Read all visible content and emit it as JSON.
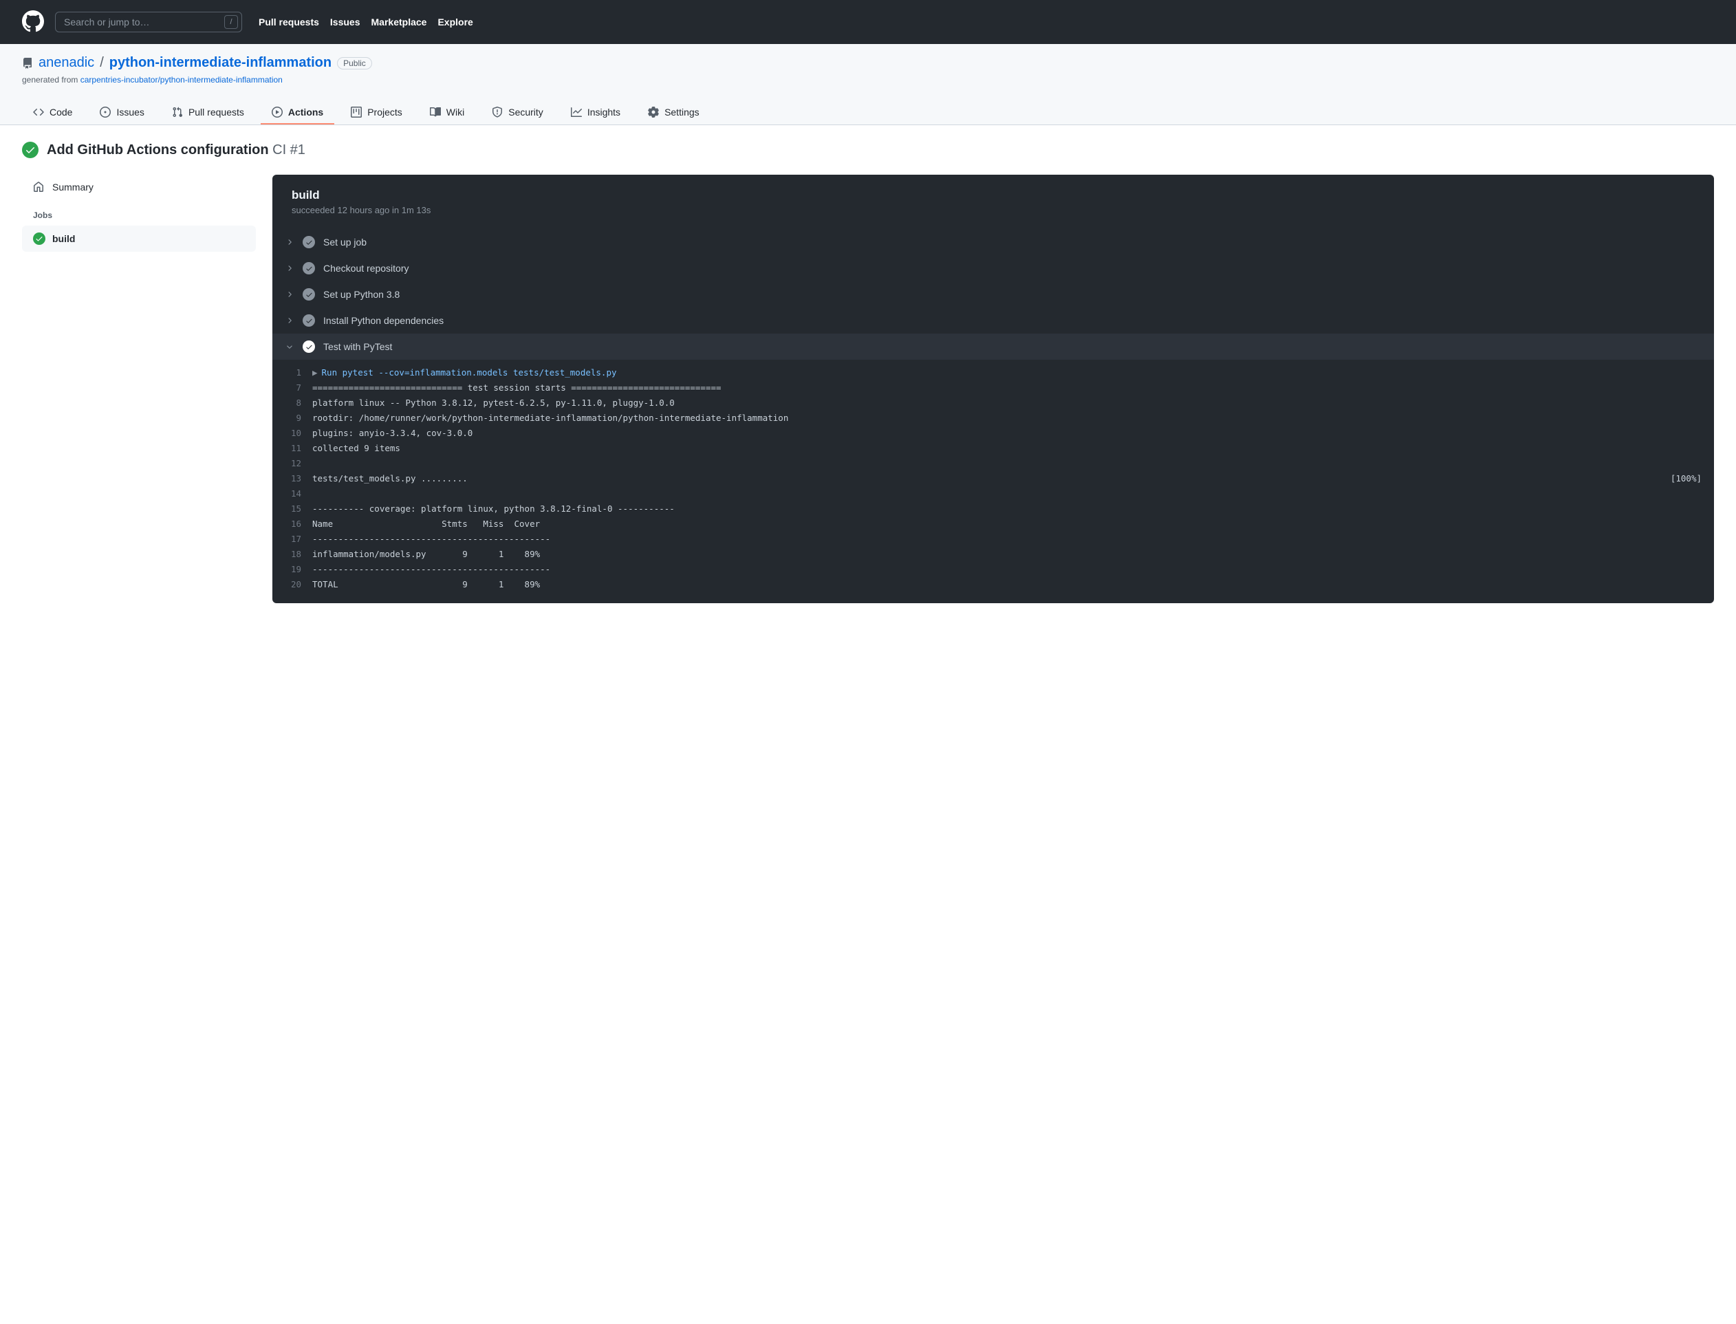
{
  "header": {
    "search_placeholder": "Search or jump to…",
    "slash": "/",
    "nav": {
      "pulls": "Pull requests",
      "issues": "Issues",
      "marketplace": "Marketplace",
      "explore": "Explore"
    }
  },
  "repo": {
    "owner": "anenadic",
    "name": "python-intermediate-inflammation",
    "visibility": "Public",
    "generated_prefix": "generated from ",
    "generated_link": "carpentries-incubator/python-intermediate-inflammation",
    "tabs": {
      "code": "Code",
      "issues": "Issues",
      "pulls": "Pull requests",
      "actions": "Actions",
      "projects": "Projects",
      "wiki": "Wiki",
      "security": "Security",
      "insights": "Insights",
      "settings": "Settings"
    }
  },
  "run": {
    "title": "Add GitHub Actions configuration",
    "workflow_ref": "CI #1",
    "sidebar": {
      "summary": "Summary",
      "jobs_label": "Jobs",
      "job_name": "build"
    },
    "panel": {
      "job_name": "build",
      "status": "succeeded 12 hours ago in 1m 13s"
    },
    "steps": {
      "setup_job": "Set up job",
      "checkout": "Checkout repository",
      "setup_python": "Set up Python 3.8",
      "install_deps": "Install Python dependencies",
      "test_pytest": "Test with PyTest"
    },
    "log": {
      "lines": [
        {
          "n": "1",
          "cmd": true,
          "text": "Run pytest --cov=inflammation.models tests/test_models.py"
        },
        {
          "n": "7",
          "text": "============================= test session starts ============================="
        },
        {
          "n": "8",
          "text": "platform linux -- Python 3.8.12, pytest-6.2.5, py-1.11.0, pluggy-1.0.0"
        },
        {
          "n": "9",
          "text": "rootdir: /home/runner/work/python-intermediate-inflammation/python-intermediate-inflammation"
        },
        {
          "n": "10",
          "text": "plugins: anyio-3.3.4, cov-3.0.0"
        },
        {
          "n": "11",
          "text": "collected 9 items"
        },
        {
          "n": "12",
          "text": ""
        },
        {
          "n": "13",
          "text": "tests/test_models.py .........",
          "right": "[100%]"
        },
        {
          "n": "14",
          "text": ""
        },
        {
          "n": "15",
          "text": "---------- coverage: platform linux, python 3.8.12-final-0 -----------"
        },
        {
          "n": "16",
          "text": "Name                     Stmts   Miss  Cover"
        },
        {
          "n": "17",
          "text": "----------------------------------------------"
        },
        {
          "n": "18",
          "text": "inflammation/models.py       9      1    89%"
        },
        {
          "n": "19",
          "text": "----------------------------------------------"
        },
        {
          "n": "20",
          "text": "TOTAL                        9      1    89%"
        }
      ]
    }
  }
}
